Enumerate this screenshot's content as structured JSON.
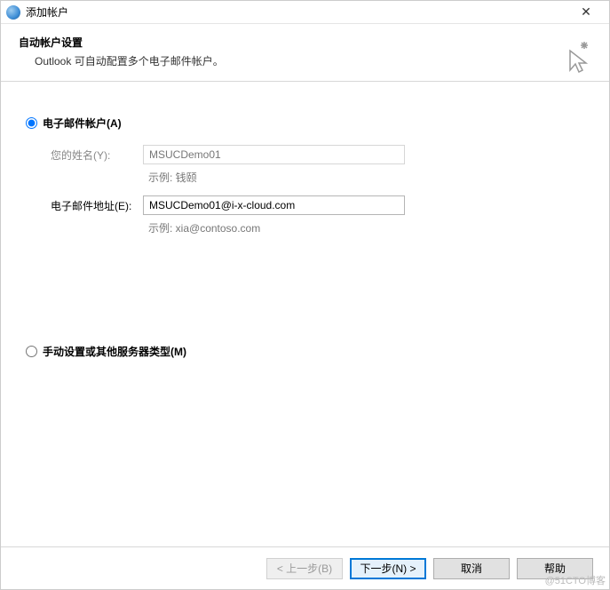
{
  "window": {
    "title": "添加帐户",
    "close_glyph": "✕"
  },
  "header": {
    "heading": "自动帐户设置",
    "subheading": "Outlook 可自动配置多个电子邮件帐户。"
  },
  "options": {
    "email_account_label": "电子邮件帐户(A)",
    "manual_label": "手动设置或其他服务器类型(M)",
    "selected": "email"
  },
  "form": {
    "name_label": "您的姓名(Y):",
    "name_value": "MSUCDemo01",
    "name_example": "示例: 钱颐",
    "email_label": "电子邮件地址(E):",
    "email_value": "MSUCDemo01@i-x-cloud.com",
    "email_example": "示例: xia@contoso.com"
  },
  "buttons": {
    "back": "< 上一步(B)",
    "next": "下一步(N) >",
    "cancel": "取消",
    "help": "帮助"
  },
  "watermark": "@51CTO博客"
}
